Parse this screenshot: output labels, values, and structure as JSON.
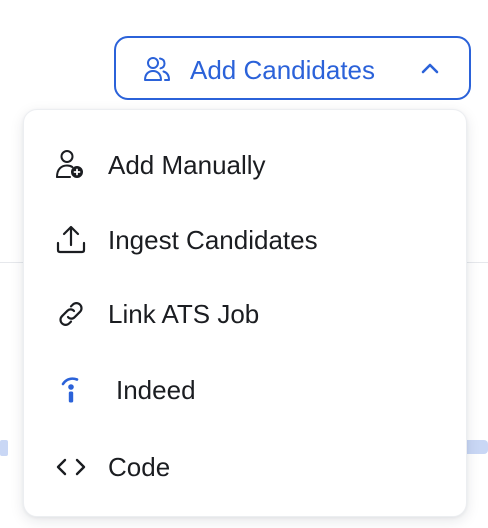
{
  "add_button": {
    "label": "Add Candidates",
    "icon": "users-icon",
    "chevron": "chevron-up-icon",
    "accent_color": "#2b62d9"
  },
  "menu": {
    "items": [
      {
        "label": "Add Manually",
        "icon": "user-plus-icon"
      },
      {
        "label": "Ingest Candidates",
        "icon": "upload-icon"
      },
      {
        "label": "Link ATS Job",
        "icon": "link-icon"
      },
      {
        "label": "Indeed",
        "icon": "indeed-icon",
        "icon_color": "#2b62d9"
      },
      {
        "label": "Code",
        "icon": "code-icon"
      }
    ]
  }
}
